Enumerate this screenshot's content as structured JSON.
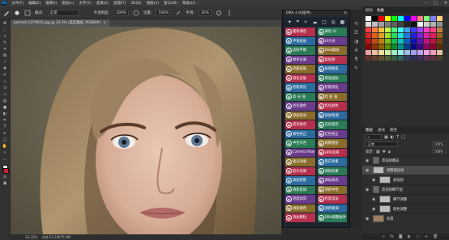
{
  "menubar": {
    "items": [
      "文件(F)",
      "编辑(E)",
      "图像(I)",
      "图层(L)",
      "文字(Y)",
      "选择(S)",
      "滤镜(T)",
      "3D(D)",
      "视图(V)",
      "窗口(W)",
      "帮助(H)"
    ]
  },
  "options": {
    "mode_label": "模式:",
    "mode_value": "正常",
    "opacity_label": "不透明度:",
    "opacity_value": "100%",
    "flow_label": "流量:",
    "flow_value": "100%",
    "smoothing_label": "平滑:",
    "smoothing_value": "10%"
  },
  "document": {
    "tab_title": "portrait-1379025.jpg @ 33.3% (选区图层, RGB/8#)",
    "close": "×"
  },
  "status": {
    "zoom": "33.33%",
    "doc_size": "文档:25.1M/75.0M"
  },
  "dra": {
    "title": "DRA 3.0(插件)",
    "buttons": [
      [
        "曼修调色",
        "调色 UI"
      ],
      [
        "平滑皮肤",
        "UI大光"
      ],
      [
        "皮肤平衡",
        "D&B磨皮"
      ],
      [
        "频率分离",
        "高低频"
      ],
      [
        "轻磨皮肤",
        "质感磨皮"
      ],
      [
        "锐化皮肤",
        "增强皮肤"
      ],
      [
        "智能锐化",
        "智能锐化"
      ],
      [
        "高 光 强",
        "暗 部 强"
      ],
      [
        "亮化颜色",
        "暗化颜色"
      ],
      [
        "添加高光",
        "添加暗调"
      ],
      [
        "提亮肤色",
        "去色提亮"
      ],
      [
        "黄色校正",
        "红色校正"
      ],
      [
        "中性灰色",
        "观察图层"
      ],
      [
        "Camera Raw",
        "HDR效果"
      ],
      [
        "柔光效果",
        "黑白效果"
      ],
      [
        "胶片效果",
        "清新效果"
      ],
      [
        "添加阴影",
        "添加高光"
      ],
      [
        "清新胶调",
        "清新中性"
      ],
      [
        "轻度加深",
        "轻度减淡"
      ],
      [
        "清新颜色",
        "清新暖调"
      ],
      [
        "添加颗粒",
        "DRA调整插件"
      ]
    ]
  },
  "swatches_panel": {
    "tabs": [
      "颜色",
      "色板"
    ]
  },
  "layers": {
    "tabs": [
      "图层",
      "通道",
      "路径"
    ],
    "blend": "正常",
    "opacity": "100%",
    "lock_label": "锁定:",
    "fill": "100%",
    "rows": [
      "高低频磨皮",
      "调整图层组",
      "高低频",
      "高低频细节组",
      "细节调整",
      "颜色调整",
      "背景"
    ]
  },
  "colors": {
    "accent_red": "#c0304a",
    "accent_blue": "#2f5f9a",
    "accent_green": "#2c7a55",
    "accent_purple": "#6a3a8a"
  }
}
